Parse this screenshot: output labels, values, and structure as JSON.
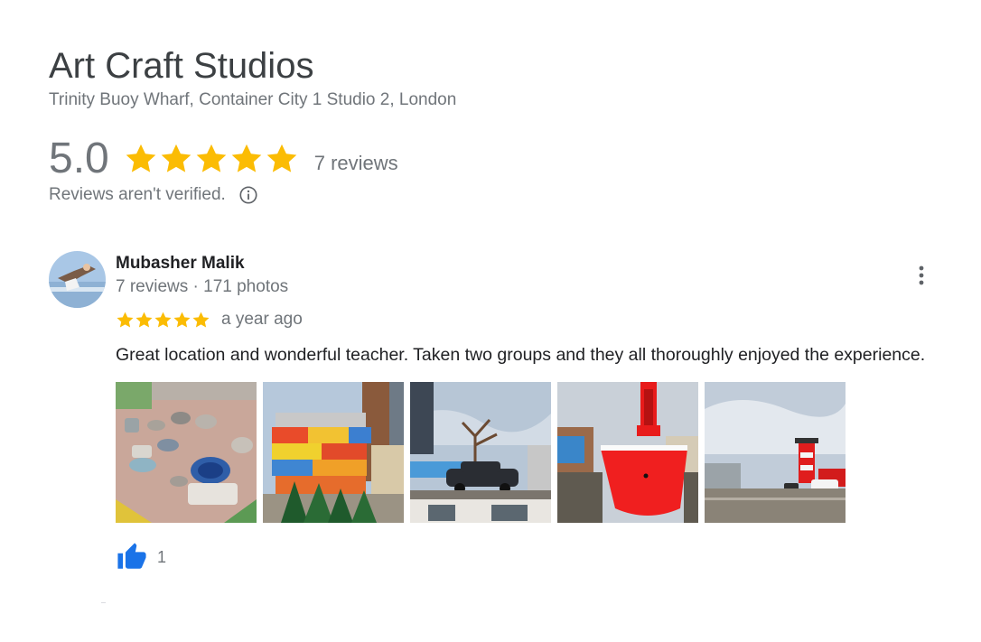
{
  "business": {
    "name": "Art Craft Studios",
    "address": "Trinity Buoy Wharf, Container City 1 Studio 2, London"
  },
  "rating": {
    "value": "5.0",
    "stars": 5,
    "reviews_label": "7 reviews",
    "verified_note": "Reviews aren't verified."
  },
  "review": {
    "reviewer_name": "Mubasher Malik",
    "reviewer_stats": "7 reviews · 171 photos",
    "stars": 5,
    "time": "a year ago",
    "text": "Great location and wonderful teacher. Taken two groups and they all thoroughly enjoyed the experience.",
    "likes": "1",
    "photos": [
      {
        "subject": "pottery-on-table"
      },
      {
        "subject": "container-city-building"
      },
      {
        "subject": "car-on-roof"
      },
      {
        "subject": "red-lightship"
      },
      {
        "subject": "lighthouse-wharf"
      }
    ]
  },
  "colors": {
    "star": "#fbbc04",
    "like": "#1a73e8",
    "muted_text": "#70757a"
  },
  "icons": [
    "star-icon",
    "info-icon",
    "more-vert-icon",
    "thumbs-up-icon"
  ]
}
